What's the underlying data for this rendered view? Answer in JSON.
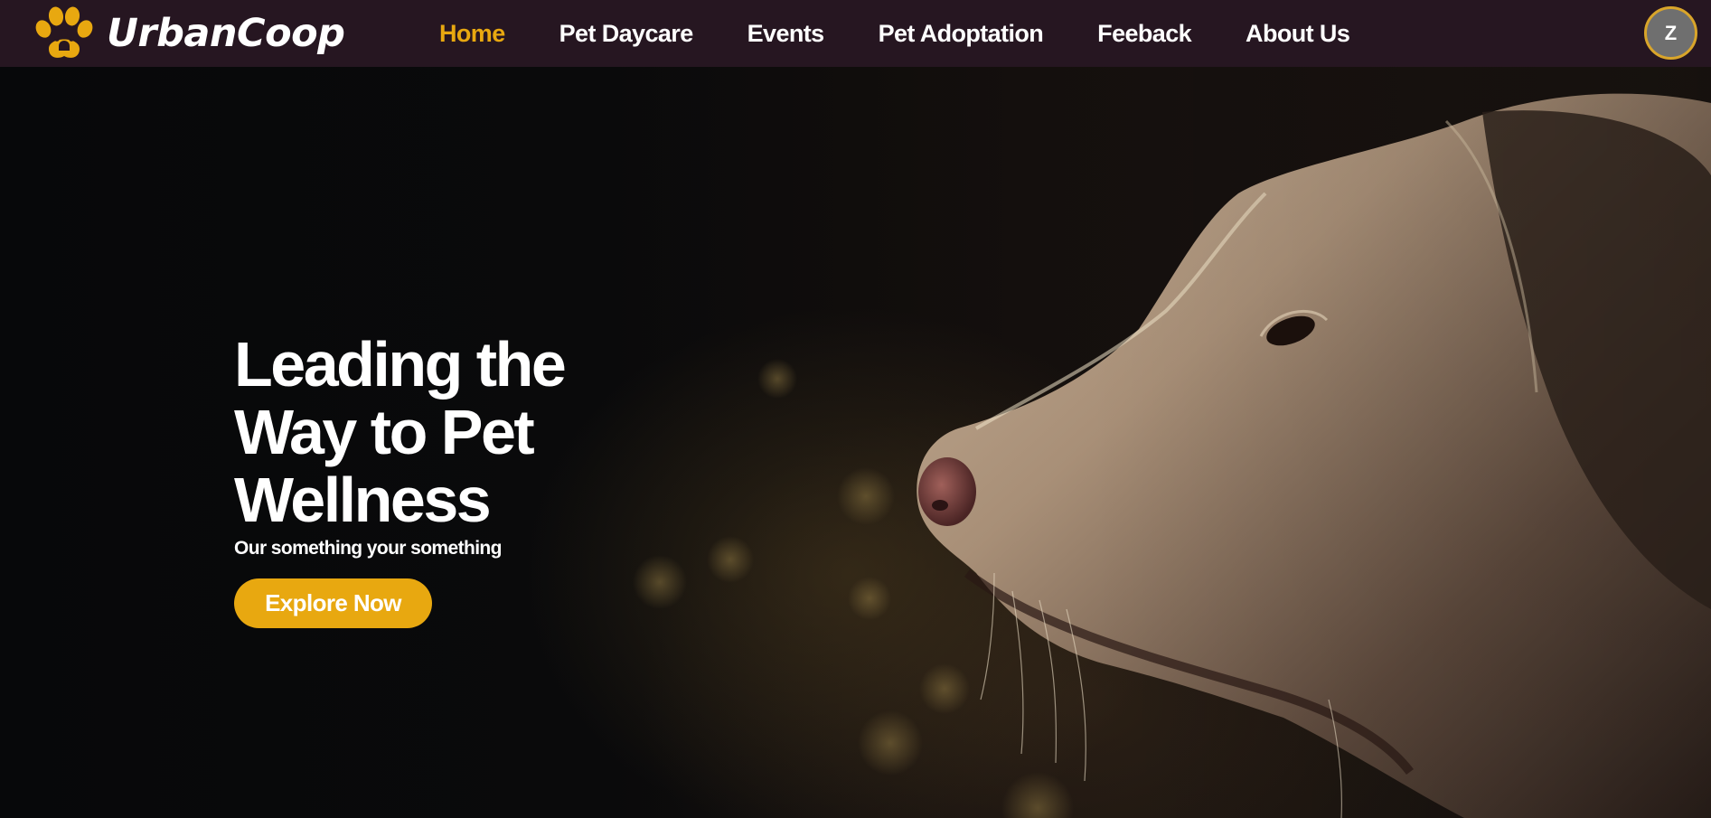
{
  "brand": {
    "name": "UrbanCoop",
    "logo_icon": "paw-people-icon",
    "accent_color": "#e8a810"
  },
  "nav": {
    "items": [
      {
        "label": "Home",
        "active": true
      },
      {
        "label": "Pet Daycare",
        "active": false
      },
      {
        "label": "Events",
        "active": false
      },
      {
        "label": "Pet Adoptation",
        "active": false
      },
      {
        "label": "Feeback",
        "active": false
      },
      {
        "label": "About Us",
        "active": false
      }
    ]
  },
  "user": {
    "avatar_initial": "Z"
  },
  "hero": {
    "title": "Leading the Way to Pet Wellness",
    "subtitle": "Our something your something",
    "cta_label": "Explore Now",
    "image_subject": "dog-profile-image"
  },
  "colors": {
    "navbar_bg": "#261621",
    "hero_bg": "#08090b",
    "active_link": "#e8a810",
    "button_bg": "#e8a810",
    "text": "#ffffff"
  }
}
